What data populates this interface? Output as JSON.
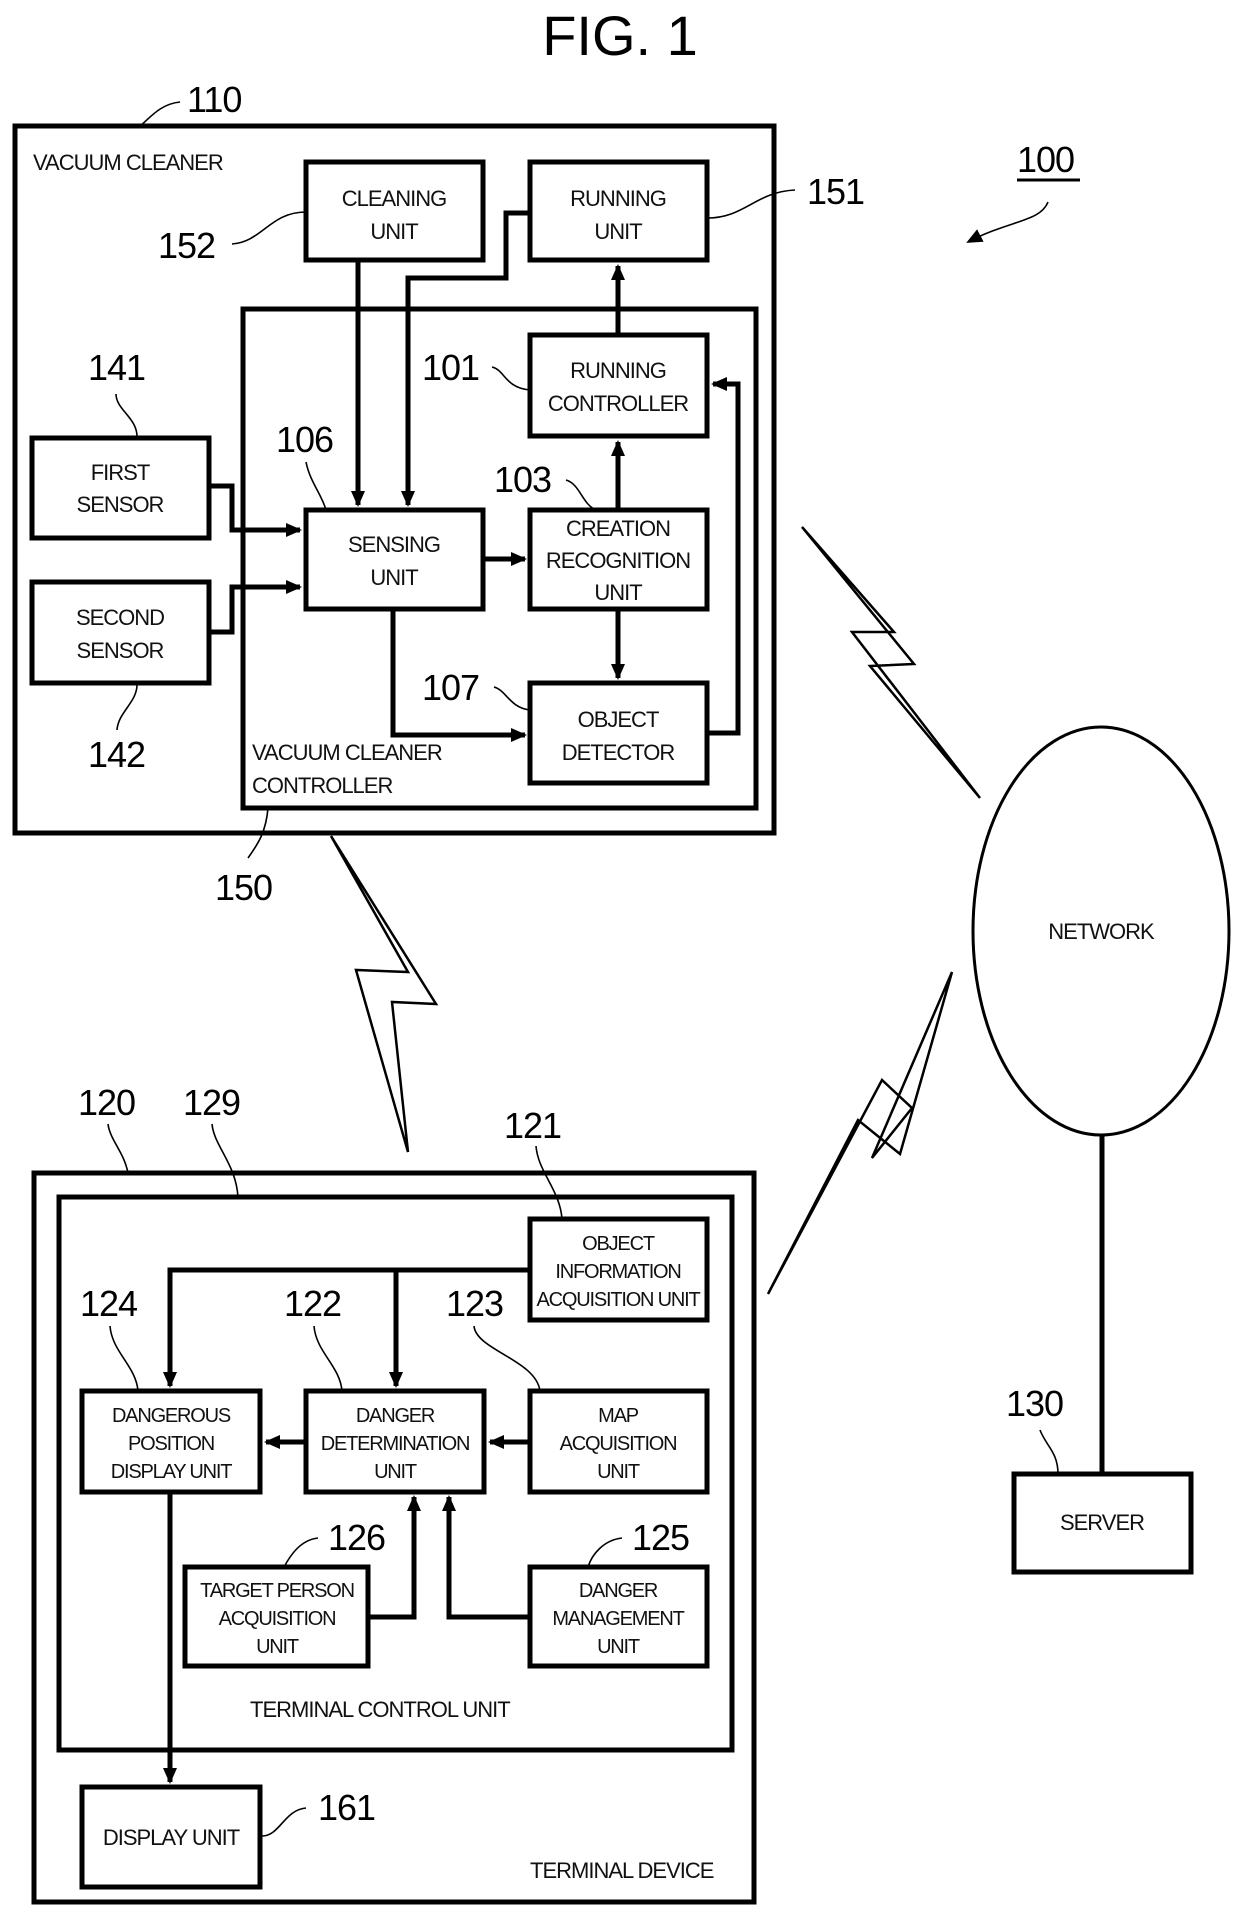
{
  "figure": {
    "title": "FIG. 1",
    "system_ref": "100"
  },
  "vacuum_cleaner": {
    "ref": "110",
    "label": "VACUUM CLEANER",
    "controller": {
      "ref": "150",
      "label_lines": [
        "VACUUM CLEANER",
        "CONTROLLER"
      ]
    },
    "units": {
      "cleaning": {
        "ref": "152",
        "lines": [
          "CLEANING",
          "UNIT"
        ]
      },
      "running": {
        "ref": "151",
        "lines": [
          "RUNNING",
          "UNIT"
        ]
      },
      "running_controller": {
        "ref": "101",
        "lines": [
          "RUNNING",
          "CONTROLLER"
        ]
      },
      "sensing": {
        "ref": "106",
        "lines": [
          "SENSING",
          "UNIT"
        ]
      },
      "creation_recognition": {
        "ref": "103",
        "lines": [
          "CREATION",
          "RECOGNITION",
          "UNIT"
        ]
      },
      "object_detector": {
        "ref": "107",
        "lines": [
          "OBJECT",
          "DETECTOR"
        ]
      },
      "first_sensor": {
        "ref": "141",
        "lines": [
          "FIRST",
          "SENSOR"
        ]
      },
      "second_sensor": {
        "ref": "142",
        "lines": [
          "SECOND",
          "SENSOR"
        ]
      }
    }
  },
  "network": {
    "label": "NETWORK"
  },
  "server": {
    "ref": "130",
    "label": "SERVER"
  },
  "terminal_device": {
    "ref": "120",
    "label": "TERMINAL DEVICE",
    "control_unit": {
      "ref": "129",
      "label": "TERMINAL CONTROL UNIT"
    },
    "units": {
      "object_info": {
        "ref": "121",
        "lines": [
          "OBJECT",
          "INFORMATION",
          "ACQUISITION UNIT"
        ]
      },
      "danger_determination": {
        "ref": "122",
        "lines": [
          "DANGER",
          "DETERMINATION",
          "UNIT"
        ]
      },
      "map_acquisition": {
        "ref": "123",
        "lines": [
          "MAP",
          "ACQUISITION",
          "UNIT"
        ]
      },
      "dangerous_position": {
        "ref": "124",
        "lines": [
          "DANGEROUS",
          "POSITION",
          "DISPLAY UNIT"
        ]
      },
      "danger_management": {
        "ref": "125",
        "lines": [
          "DANGER",
          "MANAGEMENT",
          "UNIT"
        ]
      },
      "target_person": {
        "ref": "126",
        "lines": [
          "TARGET PERSON",
          "ACQUISITION",
          "UNIT"
        ]
      },
      "display": {
        "ref": "161",
        "label": "DISPLAY UNIT"
      }
    }
  }
}
